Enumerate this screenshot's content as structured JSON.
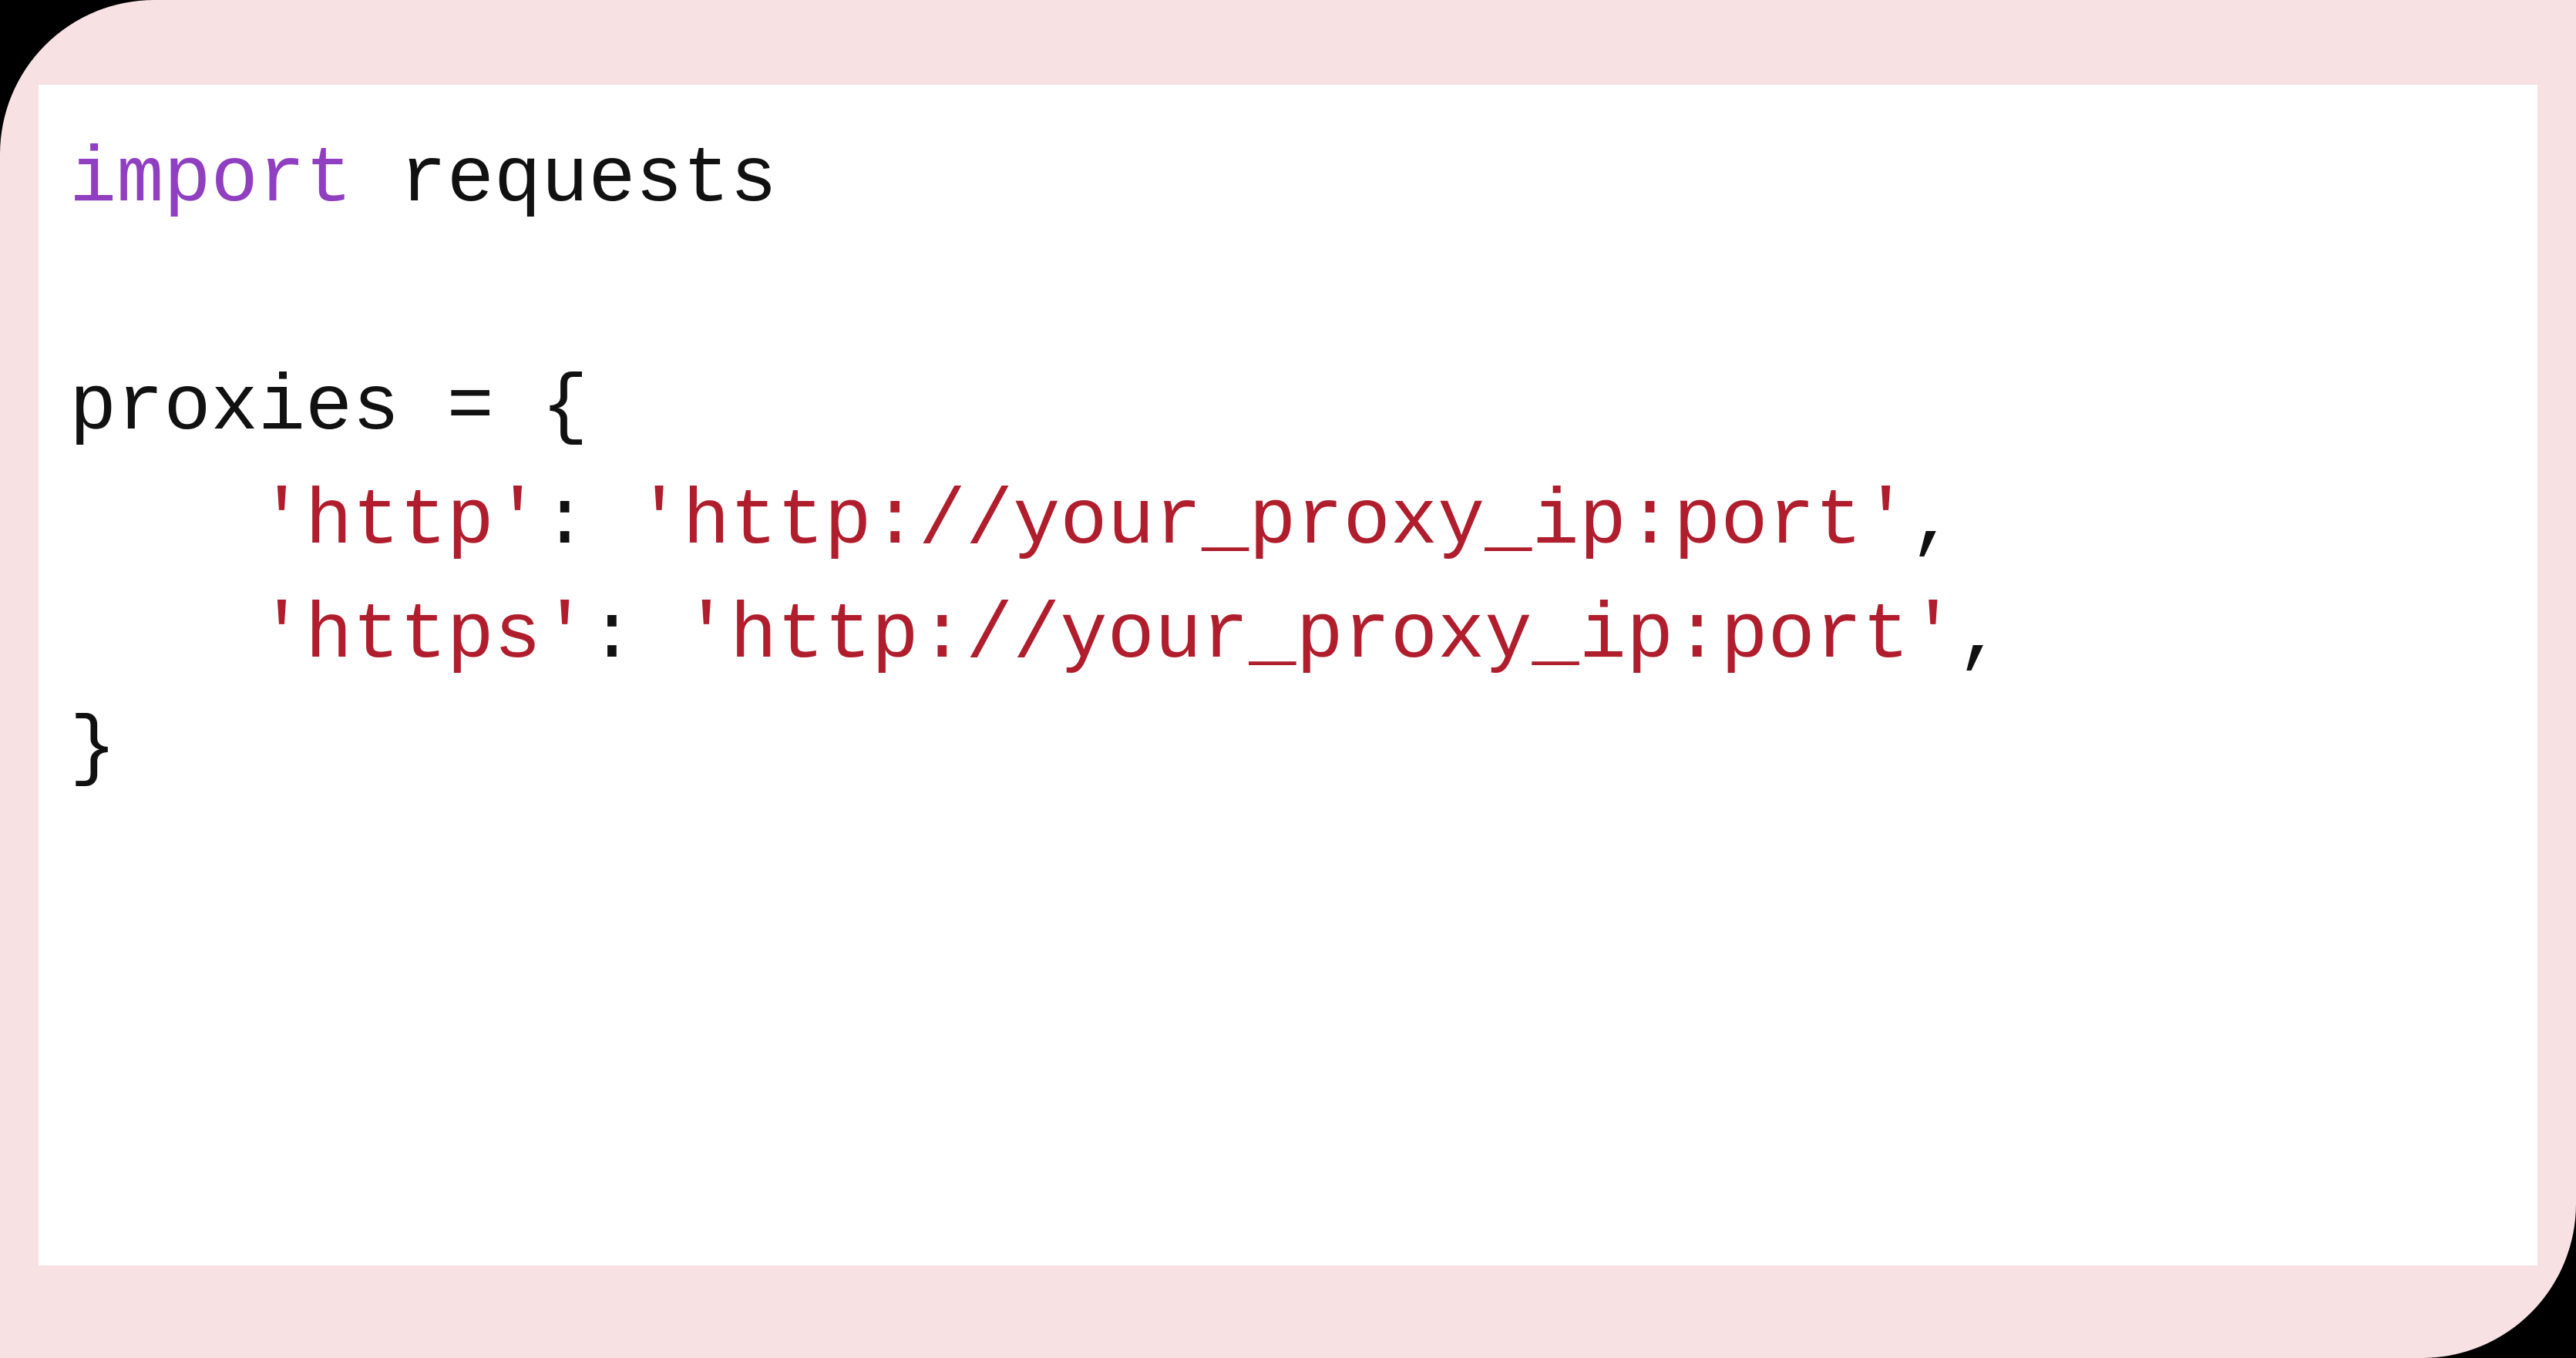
{
  "code": {
    "line1": {
      "kw": "import",
      "sp": " ",
      "mod": "requests"
    },
    "line2": "",
    "line3": "proxies = {",
    "line4": {
      "indent": "    ",
      "key": "'http'",
      "colon": ": ",
      "val": "'http://your_proxy_ip:port'",
      "comma": ","
    },
    "line5": {
      "indent": "    ",
      "key": "'https'",
      "colon": ": ",
      "val": "'http://your_proxy_ip:port'",
      "comma": ","
    },
    "line6": "}"
  }
}
